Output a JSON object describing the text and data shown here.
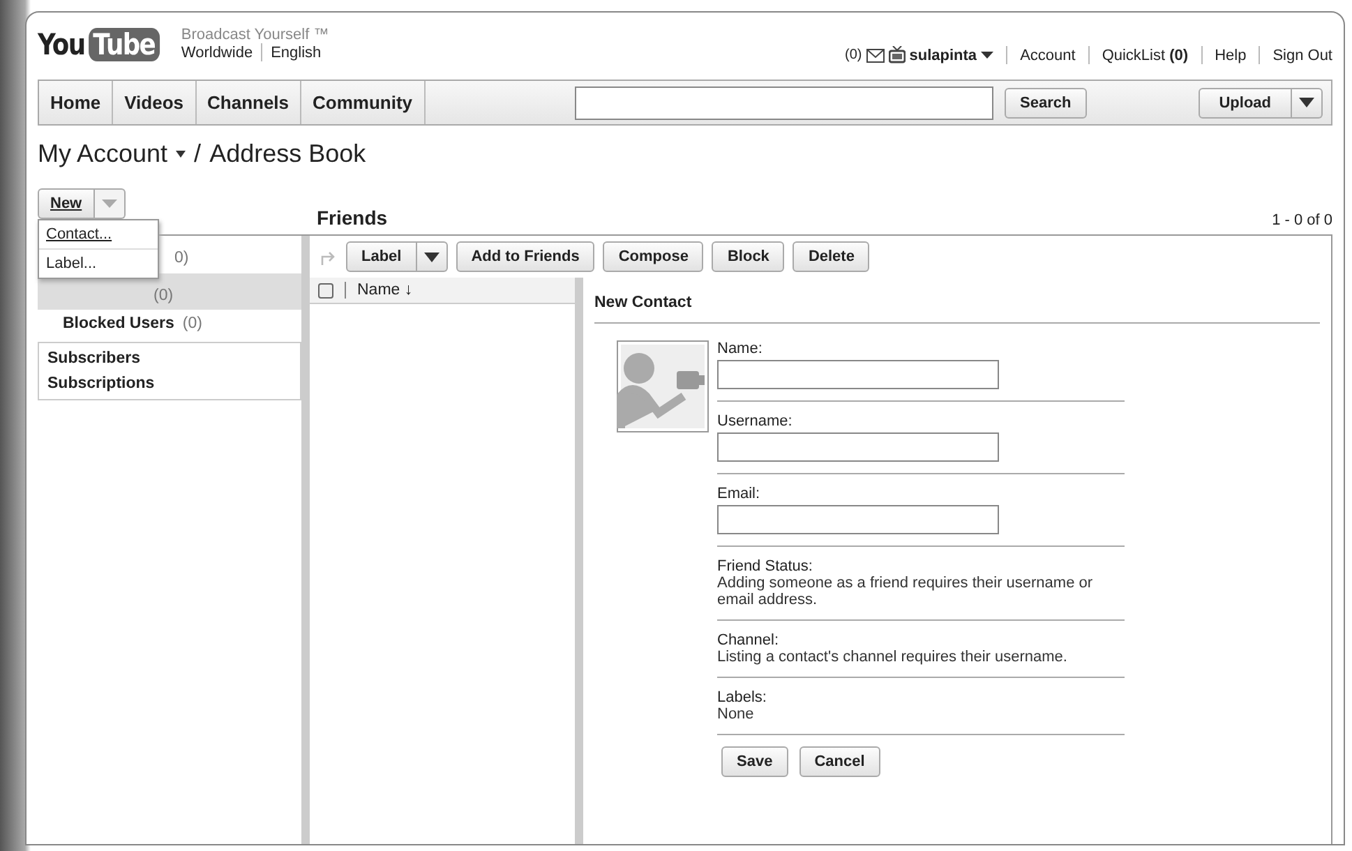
{
  "header": {
    "logo": {
      "left": "You",
      "right": "Tube"
    },
    "tagline": "Broadcast Yourself ™",
    "region": "Worldwide",
    "language": "English",
    "inbox_count": "(0)",
    "username": "sulapinta",
    "links": [
      "Account",
      "QuickList **(0)**",
      "Help",
      "Sign Out"
    ]
  },
  "nav": {
    "tabs": [
      {
        "label": "Home",
        "selected": false
      },
      {
        "label": "Videos",
        "selected": false
      },
      {
        "label": "Channels",
        "selected": false
      },
      {
        "label": "Community",
        "selected": false
      }
    ],
    "search_button": "Search",
    "upload_button": "Upload"
  },
  "breadcrumb": {
    "parent": "My Account",
    "separator": "/",
    "current": "Address Book"
  },
  "new_button": "New",
  "new_menu": {
    "expanded": true,
    "items": [
      "Contact...",
      "Label..."
    ]
  },
  "sidebar": {
    "items": [
      {
        "count": "0)",
        "selected": false
      },
      {
        "count": "(0)",
        "selected": true
      },
      {
        "label": "Blocked Users",
        "count": "(0)",
        "selected": false
      }
    ],
    "sections": [
      "Subscribers",
      "Subscriptions"
    ]
  },
  "list": {
    "title": "Friends",
    "pagination": "1 - 0 of 0",
    "toolbar": [
      "Label",
      "Add to Friends",
      "Compose",
      "Block",
      "Delete"
    ],
    "select_all": {
      "checked": false
    },
    "column": "Name ↓"
  },
  "form": {
    "title": "New Contact",
    "fields": [
      {
        "label": "Name:"
      },
      {
        "label": "Username:"
      },
      {
        "label": "Email:"
      }
    ],
    "info": [
      {
        "label": "Friend Status:",
        "text": "Adding someone as a friend requires their username or email address."
      },
      {
        "label": "Channel:",
        "text": "Listing a contact's channel requires their username."
      },
      {
        "label": "Labels:",
        "text": "None"
      }
    ],
    "buttons": [
      "Save",
      "Cancel"
    ]
  }
}
